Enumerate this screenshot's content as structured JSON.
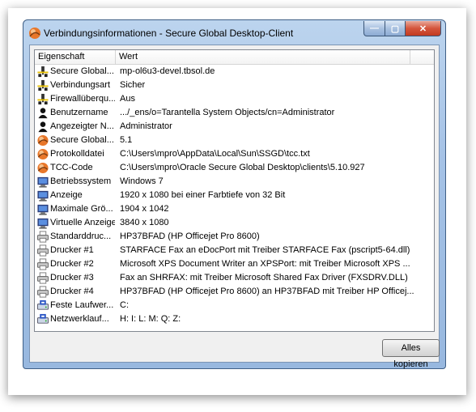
{
  "window": {
    "title": "Verbindungsinformationen - Secure Global Desktop-Client"
  },
  "controls": {
    "minimize": "—",
    "maximize": "▢",
    "close": "✕"
  },
  "list": {
    "columns": [
      "Eigenschaft",
      "Wert"
    ],
    "rows": [
      {
        "icon": "network-connection-icon",
        "property": "Secure Global...",
        "value": "mp-ol6u3-devel.tbsol.de"
      },
      {
        "icon": "network-connection-icon",
        "property": "Verbindungsart",
        "value": "Sicher"
      },
      {
        "icon": "network-connection-icon",
        "property": "Firewallüberqu...",
        "value": "Aus"
      },
      {
        "icon": "user-icon",
        "property": "Benutzername",
        "value": ".../_ens/o=Tarantella System Objects/cn=Administrator"
      },
      {
        "icon": "user-icon",
        "property": "Angezeigter N...",
        "value": "Administrator"
      },
      {
        "icon": "sgd-logo-icon",
        "property": "Secure Global...",
        "value": "5.1"
      },
      {
        "icon": "sgd-logo-icon",
        "property": "Protokolldatei",
        "value": "C:\\Users\\mpro\\AppData\\Local\\Sun\\SSGD\\tcc.txt"
      },
      {
        "icon": "sgd-logo-icon",
        "property": "TCC-Code",
        "value": "C:\\Users\\mpro\\Oracle Secure Global Desktop\\clients\\5.10.927"
      },
      {
        "icon": "computer-icon",
        "property": "Betriebssystem",
        "value": "Windows 7"
      },
      {
        "icon": "computer-icon",
        "property": "Anzeige",
        "value": " 1920 x 1080 bei einer Farbtiefe von 32 Bit"
      },
      {
        "icon": "computer-icon",
        "property": "Maximale Grö...",
        "value": "1904 x 1042"
      },
      {
        "icon": "computer-icon",
        "property": "Virtuelle Anzeige",
        "value": "3840 x 1080"
      },
      {
        "icon": "printer-icon",
        "property": "Standarddruc...",
        "value": "HP37BFAD (HP Officejet Pro 8600)"
      },
      {
        "icon": "printer-icon",
        "property": "Drucker #1",
        "value": "STARFACE Fax an eDocPort mit Treiber STARFACE Fax (pscript5-64.dll)"
      },
      {
        "icon": "printer-icon",
        "property": "Drucker #2",
        "value": "Microsoft XPS Document Writer an XPSPort: mit Treiber Microsoft XPS ..."
      },
      {
        "icon": "printer-icon",
        "property": "Drucker #3",
        "value": "Fax an SHRFAX: mit Treiber Microsoft Shared Fax Driver (FXSDRV.DLL)"
      },
      {
        "icon": "printer-icon",
        "property": "Drucker #4",
        "value": "HP37BFAD (HP Officejet Pro 8600) an HP37BFAD mit Treiber HP Officej..."
      },
      {
        "icon": "drive-icon",
        "property": "Feste Laufwer...",
        "value": "C:"
      },
      {
        "icon": "drive-icon",
        "property": "Netzwerklauf...",
        "value": "H: I: L: M: Q: Z:"
      }
    ]
  },
  "buttons": {
    "copy_all": "Alles kopieren"
  }
}
